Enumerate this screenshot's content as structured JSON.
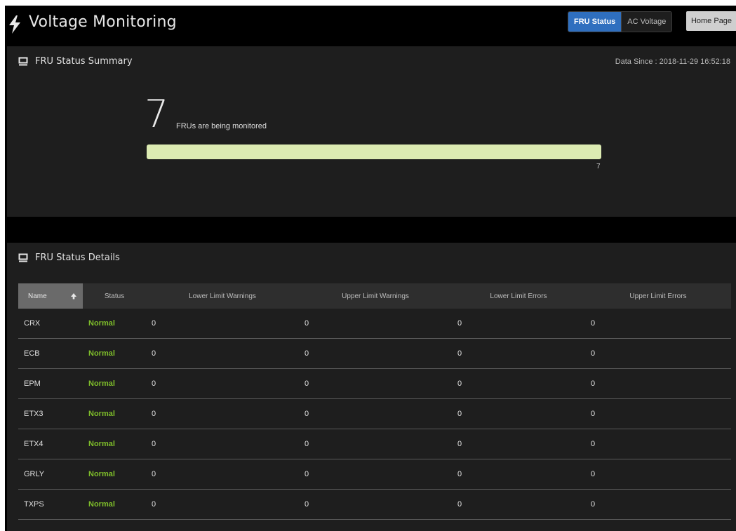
{
  "header": {
    "title": "Voltage Monitoring",
    "tabs": [
      {
        "label": "FRU Status",
        "active": true
      },
      {
        "label": "AC Voltage",
        "active": false
      }
    ],
    "home_label": "Home Page"
  },
  "summary": {
    "title": "FRU Status Summary",
    "data_since": "Data Since : 2018-11-29 16:52:18",
    "count": "7",
    "count_label": "FRUs are being monitored",
    "bar_fill_fraction": 1.0,
    "bar_value": "7"
  },
  "details": {
    "title": "FRU Status Details",
    "columns": [
      "Name",
      "Status",
      "Lower Limit Warnings",
      "Upper Limit Warnings",
      "Lower Limit Errors",
      "Upper Limit Errors"
    ],
    "rows": [
      [
        "CRX",
        "Normal",
        "0",
        "0",
        "0",
        "0"
      ],
      [
        "ECB",
        "Normal",
        "0",
        "0",
        "0",
        "0"
      ],
      [
        "EPM",
        "Normal",
        "0",
        "0",
        "0",
        "0"
      ],
      [
        "ETX3",
        "Normal",
        "0",
        "0",
        "0",
        "0"
      ],
      [
        "ETX4",
        "Normal",
        "0",
        "0",
        "0",
        "0"
      ],
      [
        "GRLY",
        "Normal",
        "0",
        "0",
        "0",
        "0"
      ],
      [
        "TXPS",
        "Normal",
        "0",
        "0",
        "0",
        "0"
      ]
    ]
  },
  "colors": {
    "accent": "#2f6fbf",
    "status_normal": "#7fbf2a",
    "bar_fill": "#dcebb2"
  },
  "icons": {
    "app": "lightning-bolt-icon",
    "panel": "monitor-icon",
    "sort": "arrow-up-icon"
  }
}
